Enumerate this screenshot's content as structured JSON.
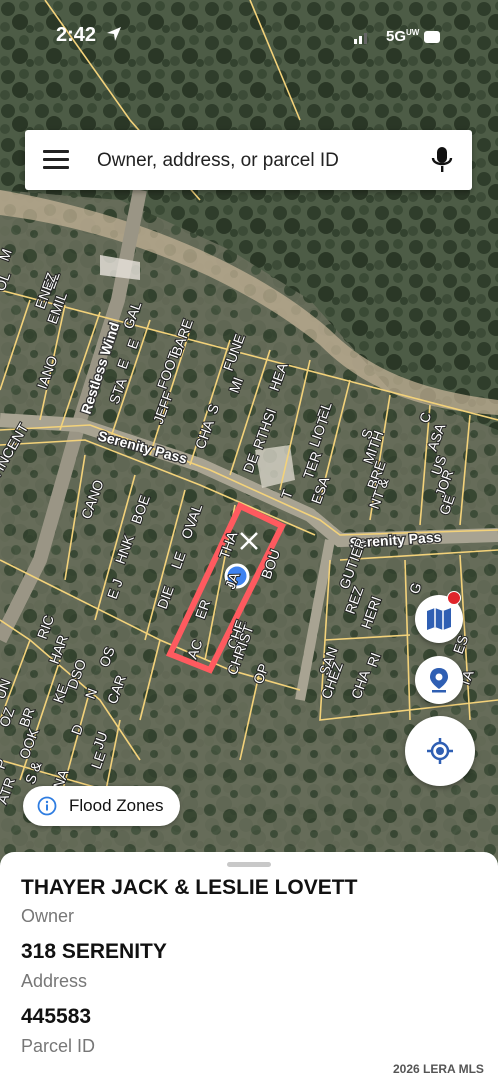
{
  "status_bar": {
    "time": "2:42",
    "network": "5G",
    "network_suffix": "UW"
  },
  "search": {
    "placeholder": "Owner, address, or parcel ID"
  },
  "map": {
    "streets": [
      "Restless Wind",
      "Serenity Pass",
      "Serenity Pass"
    ],
    "lot_labels": [
      "VINCENT",
      "OL",
      "M",
      "EL",
      "ENEZ",
      "EMIL",
      "IANO",
      "GAL",
      "E",
      "E",
      "STA",
      "BARE",
      "FOOT",
      "JEFF",
      "FUNE",
      "MI",
      "S",
      "CHA",
      "HEA",
      "RTHSI",
      "DE",
      "EL",
      "LIOT",
      "TER",
      "ESA",
      "T",
      "S",
      "MITH",
      "BRE",
      "NT &",
      "C",
      "ASA",
      "US",
      "JOR",
      "GE",
      "CANO",
      "BOE",
      "HNK",
      "E J",
      "LE",
      "DIE",
      "OVAL",
      "THA",
      "ER",
      "JA",
      "AC",
      "BOU",
      "CHE",
      "CHRIST",
      "OP",
      "RIC",
      "HAR",
      "DSO",
      "N",
      "OS",
      "CAR",
      "GUTIER",
      "REZ",
      "HERI",
      "SAN",
      "CHEZ",
      "RI",
      "CHA",
      "G",
      "ES",
      "TA",
      "KE",
      "UN",
      "OZ",
      "BR",
      "OOK",
      "S &",
      "NA",
      "JU",
      "D",
      "LE",
      "P",
      "ATR"
    ],
    "selected_parcel_color": "#ff5a5f",
    "parcel_line_color": "#f3d27a",
    "location_dot_color": "#3d82f0"
  },
  "buttons": {
    "layers_icon": "map-layers-icon",
    "pin_icon": "location-pin-icon",
    "locate_icon": "gps-locate-icon"
  },
  "flood_zones": {
    "label": "Flood Zones"
  },
  "parcel": {
    "owner": "THAYER JACK & LESLIE LOVETT",
    "owner_label": "Owner",
    "address": "318 SERENITY",
    "address_label": "Address",
    "parcel_id": "445583",
    "parcel_id_label": "Parcel ID"
  },
  "watermark": "2026 LERA MLS"
}
